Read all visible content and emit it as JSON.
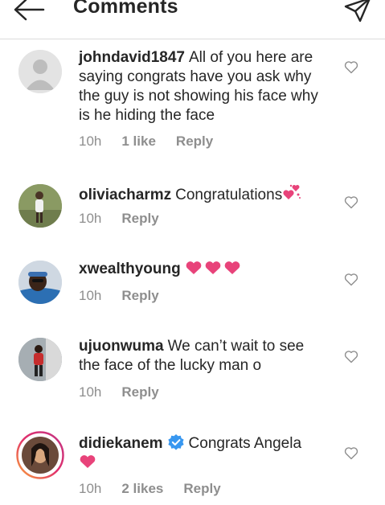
{
  "header": {
    "title": "Comments"
  },
  "comments": [
    {
      "username": "johndavid1847",
      "text": "All of you here are saying congrats have you ask why the guy is not showing his face why is he hiding the face",
      "time": "10h",
      "likes": "1 like",
      "reply": "Reply"
    },
    {
      "username": "oliviacharmz",
      "text": "Congratulations",
      "time": "10h",
      "reply": "Reply"
    },
    {
      "username": "xwealthyoung",
      "text": "",
      "time": "10h",
      "reply": "Reply"
    },
    {
      "username": "ujuonwuma",
      "text": "We can’t wait to see the face of the lucky man o",
      "time": "10h",
      "reply": "Reply"
    },
    {
      "username": "didiekanem",
      "text": "Congrats Angela",
      "time": "10h",
      "likes": "2 likes",
      "reply": "Reply"
    }
  ],
  "icons": {
    "back": "arrow-left-icon",
    "send": "paper-plane-icon",
    "like": "heart-outline-icon",
    "verified": "verified-badge-icon"
  },
  "colors": {
    "emoji_heart": "#e8437a",
    "verified": "#3897f0",
    "meta": "#8e8e8e"
  }
}
